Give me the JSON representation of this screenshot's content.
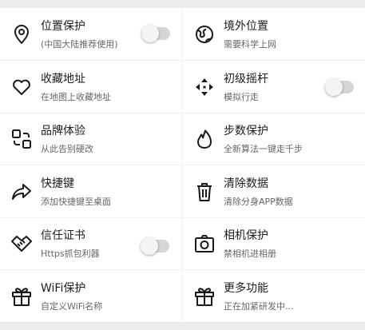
{
  "items": [
    {
      "title": "位置保护",
      "subtitle": "(中国大陆推荐使用)",
      "icon": "location-pin-icon",
      "toggle": false
    },
    {
      "title": "境外位置",
      "subtitle": "需要科学上网",
      "icon": "globe-icon"
    },
    {
      "title": "收藏地址",
      "subtitle": "在地图上收藏地址",
      "icon": "heart-icon"
    },
    {
      "title": "初级摇杆",
      "subtitle": "模拟行走",
      "icon": "move-arrows-icon",
      "toggle": false
    },
    {
      "title": "品牌体验",
      "subtitle": "从此告别硬改",
      "icon": "brand-squares-icon"
    },
    {
      "title": "步数保护",
      "subtitle": "全新算法一键走千步",
      "icon": "flame-icon"
    },
    {
      "title": "快捷键",
      "subtitle": "添加快捷键至桌面",
      "icon": "share-arrow-icon"
    },
    {
      "title": "清除数据",
      "subtitle": "清除分身APP数据",
      "icon": "trash-icon"
    },
    {
      "title": "信任证书",
      "subtitle": "Https抓包利器",
      "icon": "handshake-icon",
      "toggle": false
    },
    {
      "title": "相机保护",
      "subtitle": "禁相机进相册",
      "icon": "camera-icon"
    },
    {
      "title": "WiFi保护",
      "subtitle": "自定义WiFi名称",
      "icon": "gift-icon"
    },
    {
      "title": "更多功能",
      "subtitle": "正在加紧研发中...",
      "icon": "gift-icon"
    }
  ]
}
